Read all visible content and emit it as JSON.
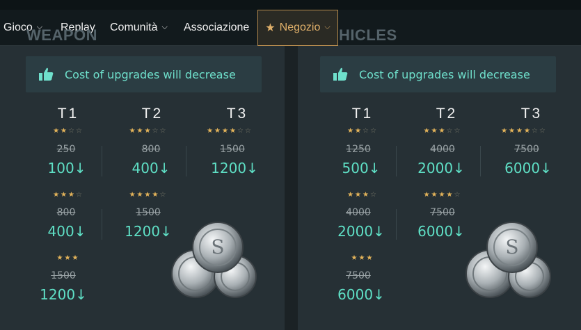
{
  "nav": {
    "gioco": "Gioco",
    "replay": "Replay",
    "comunita": "Comunità",
    "associazione": "Associazione",
    "negozio": "Negozio"
  },
  "panels": {
    "left_title": "WEAPON",
    "right_title": "HICLES",
    "banner_text": "Cost of upgrades will decrease"
  },
  "tiers": {
    "t1": "T1",
    "t2": "T2",
    "t3": "T3"
  },
  "left": {
    "r1": [
      {
        "old": "250",
        "new": "100↓"
      },
      {
        "old": "800",
        "new": "400↓"
      },
      {
        "old": "1500",
        "new": "1200↓"
      }
    ],
    "r2": [
      {
        "old": "800",
        "new": "400↓"
      },
      {
        "old": "1500",
        "new": "1200↓"
      }
    ],
    "r3": [
      {
        "old": "1500",
        "new": "1200↓"
      }
    ]
  },
  "right": {
    "r1": [
      {
        "old": "1250",
        "new": "500↓"
      },
      {
        "old": "4000",
        "new": "2000↓"
      },
      {
        "old": "7500",
        "new": "6000↓"
      }
    ],
    "r2": [
      {
        "old": "4000",
        "new": "2000↓"
      },
      {
        "old": "7500",
        "new": "6000↓"
      }
    ],
    "r3": [
      {
        "old": "7500",
        "new": "6000↓"
      }
    ]
  },
  "colors": {
    "accent": "#5fe0c6",
    "gold": "#e3b35a",
    "negozio_border": "#b48a4d"
  },
  "icons": {
    "thumb": "thumbs-up-icon",
    "star": "star-icon",
    "coin": "silver-coin-icon"
  }
}
